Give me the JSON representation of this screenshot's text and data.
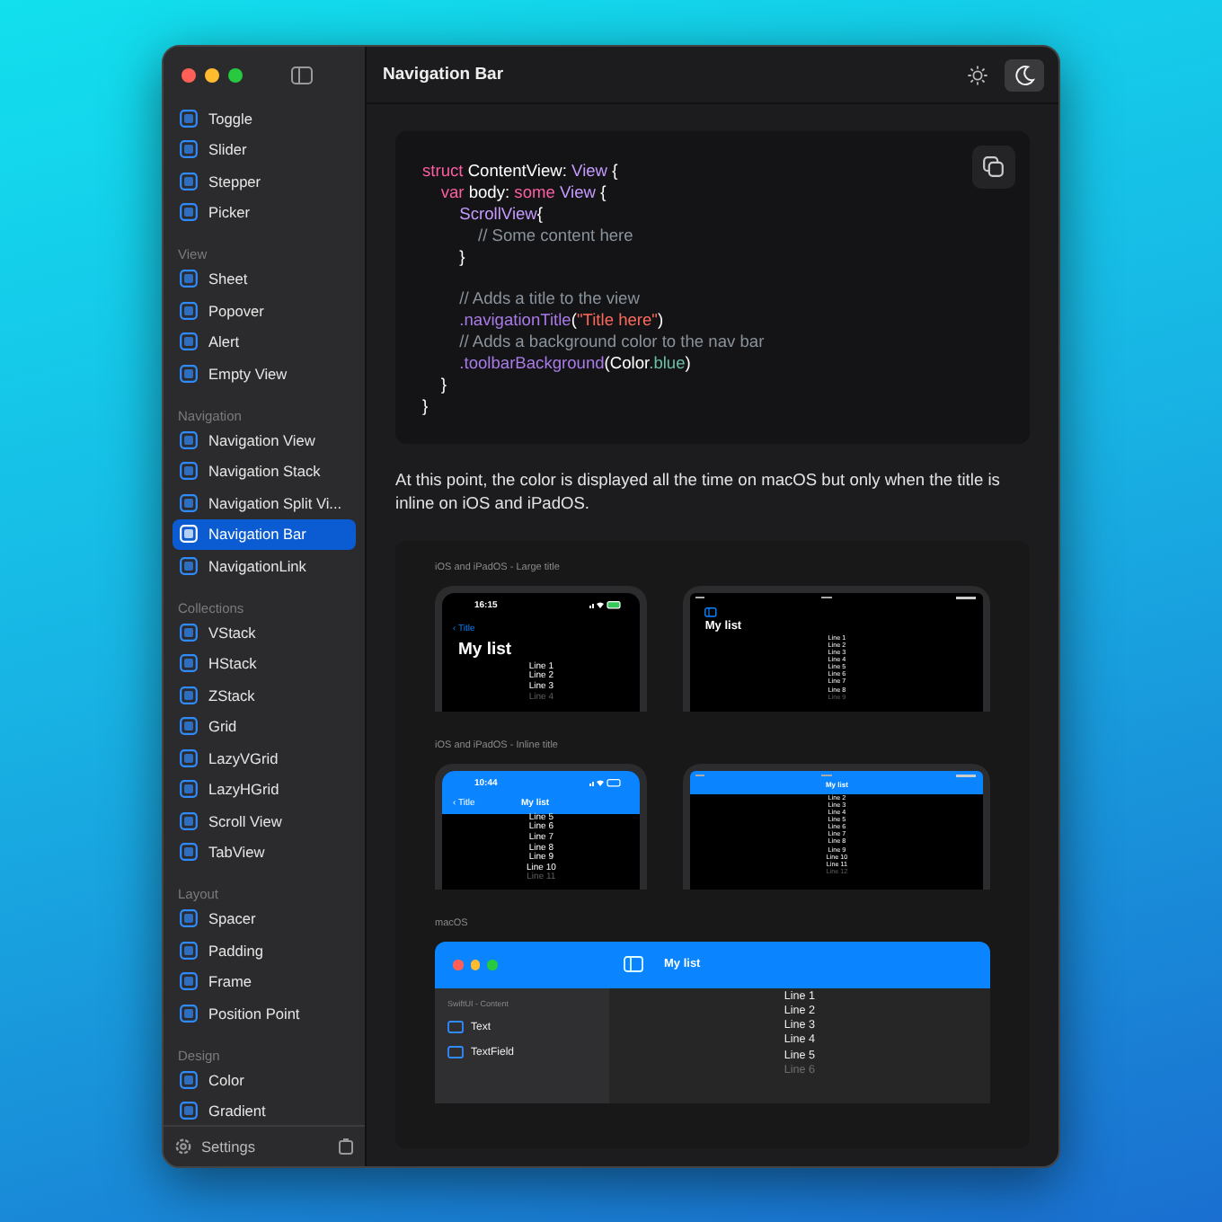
{
  "window": {
    "title": "Navigation Bar"
  },
  "appearance": [
    {
      "kind": "light",
      "selected": false
    },
    {
      "kind": "dark",
      "selected": true
    }
  ],
  "sidebar": {
    "sections": [
      {
        "items": [
          {
            "label": "Toggle",
            "selected": false
          },
          {
            "label": "Slider",
            "selected": false
          },
          {
            "label": "Stepper",
            "selected": false
          },
          {
            "label": "Picker",
            "selected": false
          }
        ]
      },
      {
        "heading": "View",
        "items": [
          {
            "label": "Sheet",
            "selected": false
          },
          {
            "label": "Popover",
            "selected": false
          },
          {
            "label": "Alert",
            "selected": false
          },
          {
            "label": "Empty View",
            "selected": false
          }
        ]
      },
      {
        "heading": "Navigation",
        "items": [
          {
            "label": "Navigation View",
            "selected": false
          },
          {
            "label": "Navigation Stack",
            "selected": false
          },
          {
            "label": "Navigation Split Vi...",
            "selected": false
          },
          {
            "label": "Navigation Bar",
            "selected": true
          },
          {
            "label": "NavigationLink",
            "selected": false
          }
        ]
      },
      {
        "heading": "Collections",
        "items": [
          {
            "label": "VStack",
            "selected": false
          },
          {
            "label": "HStack",
            "selected": false
          },
          {
            "label": "ZStack",
            "selected": false
          },
          {
            "label": "Grid",
            "selected": false
          },
          {
            "label": "LazyVGrid",
            "selected": false
          },
          {
            "label": "LazyHGrid",
            "selected": false
          },
          {
            "label": "Scroll View",
            "selected": false
          },
          {
            "label": "TabView",
            "selected": false
          }
        ]
      },
      {
        "heading": "Layout",
        "items": [
          {
            "label": "Spacer",
            "selected": false
          },
          {
            "label": "Padding",
            "selected": false
          },
          {
            "label": "Frame",
            "selected": false
          },
          {
            "label": "Position Point",
            "selected": false
          }
        ]
      },
      {
        "heading": "Design",
        "items": [
          {
            "label": "Color",
            "selected": false
          },
          {
            "label": "Gradient",
            "selected": false
          }
        ]
      }
    ],
    "footer": {
      "label": "Settings"
    }
  },
  "code": [
    {
      "tokens": [
        {
          "kind": "keyword",
          "text": "struct"
        },
        {
          "kind": "plain",
          "text": " ContentView: "
        },
        {
          "kind": "type",
          "text": "View"
        },
        {
          "kind": "plain",
          "text": " {"
        }
      ]
    },
    {
      "tokens": [
        {
          "kind": "keyword",
          "text": "    var"
        },
        {
          "kind": "plain",
          "text": " body: "
        },
        {
          "kind": "keyword",
          "text": "some"
        },
        {
          "kind": "type",
          "text": " View"
        },
        {
          "kind": "plain",
          "text": " {"
        }
      ]
    },
    {
      "tokens": [
        {
          "kind": "type",
          "text": "        ScrollView"
        },
        {
          "kind": "plain",
          "text": "{"
        }
      ]
    },
    {
      "tokens": [
        {
          "kind": "comment",
          "text": "            // Some content here"
        }
      ]
    },
    {
      "tokens": [
        {
          "kind": "plain",
          "text": "        }"
        }
      ]
    },
    {
      "gap_before": true,
      "tokens": [
        {
          "kind": "comment",
          "text": "        // Adds a title to the view"
        }
      ]
    },
    {
      "tokens": [
        {
          "kind": "function",
          "text": "        .navigationTitle"
        },
        {
          "kind": "plain",
          "text": "("
        },
        {
          "kind": "string",
          "text": "\"Title here\""
        },
        {
          "kind": "plain",
          "text": ")"
        }
      ]
    },
    {
      "tokens": [
        {
          "kind": "comment",
          "text": "        // Adds a background color to the nav bar"
        }
      ]
    },
    {
      "tokens": [
        {
          "kind": "function",
          "text": "        .toolbarBackground"
        },
        {
          "kind": "plain",
          "text": "(Color"
        },
        {
          "kind": "property",
          "text": ".blue"
        },
        {
          "kind": "plain",
          "text": ")"
        }
      ]
    },
    {
      "tokens": [
        {
          "kind": "plain",
          "text": "    }"
        }
      ]
    },
    {
      "tokens": [
        {
          "kind": "plain",
          "text": "}"
        }
      ]
    }
  ],
  "paragraph": "At this point, the color is displayed all the time on macOS but only when the title is inline on iOS and iPadOS.",
  "preview": {
    "sections": [
      {
        "title": "iOS and iPadOS - Large title",
        "devices": [
          {
            "kind": "phone",
            "inline": false,
            "time": "16:15",
            "back": "‹ Title",
            "title": "My list",
            "lines": [
              {
                "text": "Line 1",
                "faded": false
              },
              {
                "text": "Line 2",
                "faded": false
              },
              {
                "text": "Line 3",
                "faded": false
              },
              {
                "text": "Line 4",
                "faded": true
              }
            ]
          },
          {
            "kind": "tablet",
            "inline": false,
            "title": "My list",
            "lines": [
              {
                "text": "Line 1",
                "faded": false
              },
              {
                "text": "Line 2",
                "faded": false
              },
              {
                "text": "Line 3",
                "faded": false
              },
              {
                "text": "Line 4",
                "faded": false
              },
              {
                "text": "Line 5",
                "faded": false
              },
              {
                "text": "Line 6",
                "faded": false
              },
              {
                "text": "Line 7",
                "faded": false
              },
              {
                "text": "Line 8",
                "faded": false
              },
              {
                "text": "Line 9",
                "faded": true
              }
            ]
          }
        ]
      },
      {
        "title": "iOS and iPadOS - Inline title",
        "devices": [
          {
            "kind": "phone",
            "inline": true,
            "time": "10:44",
            "back": "‹ Title",
            "title": "My list",
            "lines": [
              {
                "text": "Line 5",
                "faded": false
              },
              {
                "text": "Line 6",
                "faded": false
              },
              {
                "text": "Line 7",
                "faded": false
              },
              {
                "text": "Line 8",
                "faded": false
              },
              {
                "text": "Line 9",
                "faded": false
              },
              {
                "text": "Line 10",
                "faded": false
              },
              {
                "text": "Line 11",
                "faded": true
              }
            ]
          },
          {
            "kind": "tablet",
            "inline": true,
            "title": "My list",
            "lines": [
              {
                "text": "Line 2",
                "faded": false
              },
              {
                "text": "Line 3",
                "faded": false
              },
              {
                "text": "Line 4",
                "faded": false
              },
              {
                "text": "Line 5",
                "faded": false
              },
              {
                "text": "Line 6",
                "faded": false
              },
              {
                "text": "Line 7",
                "faded": false
              },
              {
                "text": "Line 8",
                "faded": false
              },
              {
                "text": "Line 9",
                "faded": false
              },
              {
                "text": "Line 10",
                "faded": false
              },
              {
                "text": "Line 11",
                "faded": false
              },
              {
                "text": "Line 12",
                "faded": true
              }
            ]
          }
        ]
      },
      {
        "title": "macOS",
        "devices": [
          {
            "kind": "mac",
            "title": "My list",
            "sidebar_heading": "SwiftUI - Content",
            "sidebar_items": [
              "Text",
              "TextField"
            ],
            "lines": [
              {
                "text": "Line 1",
                "faded": false
              },
              {
                "text": "Line 2",
                "faded": false
              },
              {
                "text": "Line 3",
                "faded": false
              },
              {
                "text": "Line 4",
                "faded": false
              },
              {
                "text": "Line 5",
                "faded": false
              },
              {
                "text": "Line 6",
                "faded": true
              }
            ]
          }
        ]
      }
    ]
  }
}
